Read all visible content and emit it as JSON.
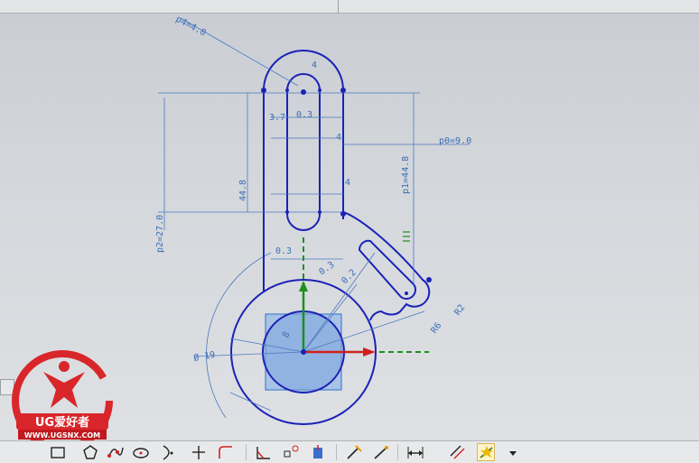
{
  "dimensions": {
    "p4": "p4=4.0",
    "p0": "p0=9.0",
    "p1": "p1=44.8",
    "p2": "p2=27.0",
    "len_44_8": "44.8",
    "d3_7": "3.7",
    "d0_3a": "0.3",
    "d0_3b": "0.3",
    "d0_3c": "0.3",
    "d4a": "4",
    "d4b": "4",
    "d4c": "4",
    "d8": "8",
    "d19": "Ø 19",
    "r2": "R2",
    "r6": "R6",
    "d0_2": "0.2"
  },
  "logo": {
    "brand": "UG爱好者",
    "url": "WWW.UGSNX.COM"
  },
  "toolbar": {
    "tools": [
      {
        "name": "rectangle-tool-icon"
      },
      {
        "name": "polygon-tool-icon"
      },
      {
        "name": "studio-spline-icon"
      },
      {
        "name": "ellipse-tool-icon"
      },
      {
        "name": "conic-tool-icon"
      },
      {
        "name": "point-tool-icon"
      },
      {
        "name": "fillet-tool-icon"
      },
      {
        "name": "chamfer-tool-icon"
      },
      {
        "name": "constraint-points-icon"
      },
      {
        "name": "offset-curve-icon"
      },
      {
        "name": "quick-trim-icon"
      },
      {
        "name": "quick-extend-icon"
      },
      {
        "name": "rapid-dimension-icon"
      },
      {
        "name": "geometric-constraint-icon"
      },
      {
        "name": "auto-constraint-icon"
      }
    ]
  },
  "colors": {
    "geometry": "#1a22b8",
    "dimension": "#3b6fb6",
    "axis_x": "#d42020",
    "axis_y": "#1f8f1f",
    "logo_red": "#d9262a"
  }
}
